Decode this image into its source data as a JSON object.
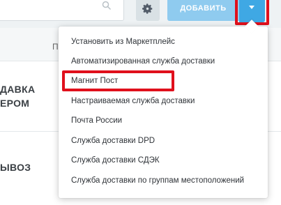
{
  "toolbar": {
    "search_placeholder": "",
    "add_button_label": "ДОБАВИТЬ"
  },
  "table": {
    "header_partial": "П",
    "rows": [
      {
        "line1": "ДАВКА",
        "line2": "ЕРОМ"
      },
      {
        "line1": "ЫВОЗ"
      }
    ]
  },
  "menu": {
    "items": [
      {
        "label": "Установить из Маркетплейс"
      },
      {
        "label": "Автоматизированная служба доставки"
      },
      {
        "label": "Магнит Пост"
      },
      {
        "label": "Настраиваемая служба доставки"
      },
      {
        "label": "Почта России"
      },
      {
        "label": "Служба доставки DPD"
      },
      {
        "label": "Служба доставки СДЭК"
      },
      {
        "label": "Служба доставки по группам местоположений"
      }
    ]
  },
  "colors": {
    "add_button": "#8fcbef",
    "dropdown_toggle": "#3fa8e4",
    "highlight_border": "#e0101c"
  },
  "icons": {
    "search": "search-icon",
    "settings": "gear-icon",
    "toggle": "caret-down-icon"
  }
}
